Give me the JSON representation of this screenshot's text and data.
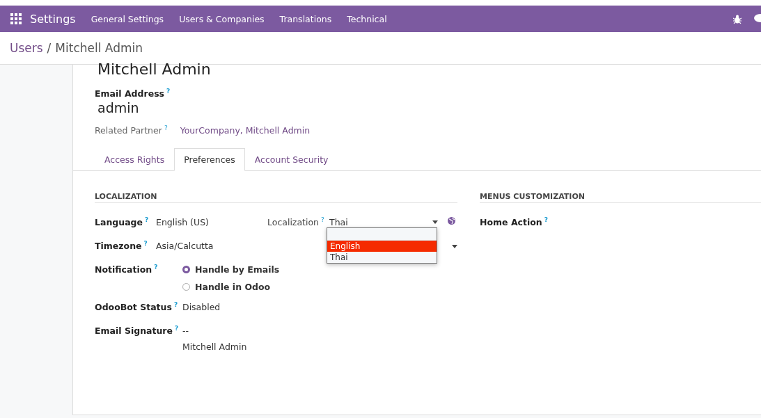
{
  "navbar": {
    "app_name": "Settings",
    "menu": [
      "General Settings",
      "Users & Companies",
      "Translations",
      "Technical"
    ]
  },
  "breadcrumb": {
    "parent": "Users",
    "separator": "/",
    "current": "Mitchell Admin"
  },
  "record": {
    "title": "Mitchell Admin",
    "email_label": "Email Address",
    "email_help": "?",
    "email": "admin",
    "partner_label": "Related Partner",
    "partner_help": "?",
    "partner": "YourCompany, Mitchell Admin"
  },
  "tabs": [
    {
      "label": "Access Rights",
      "selected": false
    },
    {
      "label": "Preferences",
      "selected": true
    },
    {
      "label": "Account Security",
      "selected": false
    }
  ],
  "localization": {
    "heading": "LOCALIZATION",
    "language": {
      "label": "Language",
      "help": "?",
      "value": "English (US)"
    },
    "localization_field": {
      "label": "Localization",
      "help": "?",
      "value": "Thai",
      "options": [
        {
          "label": "English",
          "highlighted": true
        },
        {
          "label": "Thai",
          "highlighted": false
        }
      ]
    },
    "timezone": {
      "label": "Timezone",
      "help": "?",
      "value": "Asia/Calcutta"
    },
    "notification": {
      "label": "Notification",
      "help": "?",
      "options": [
        {
          "label": "Handle by Emails",
          "selected": true
        },
        {
          "label": "Handle in Odoo",
          "selected": false
        }
      ]
    },
    "odoobot": {
      "label": "OdooBot Status",
      "help": "?",
      "value": "Disabled"
    },
    "signature": {
      "label": "Email Signature",
      "help": "?",
      "lines": [
        "--",
        "Mitchell Admin"
      ]
    }
  },
  "menus": {
    "heading": "MENUS CUSTOMIZATION",
    "home_action": {
      "label": "Home Action",
      "help": "?"
    }
  }
}
